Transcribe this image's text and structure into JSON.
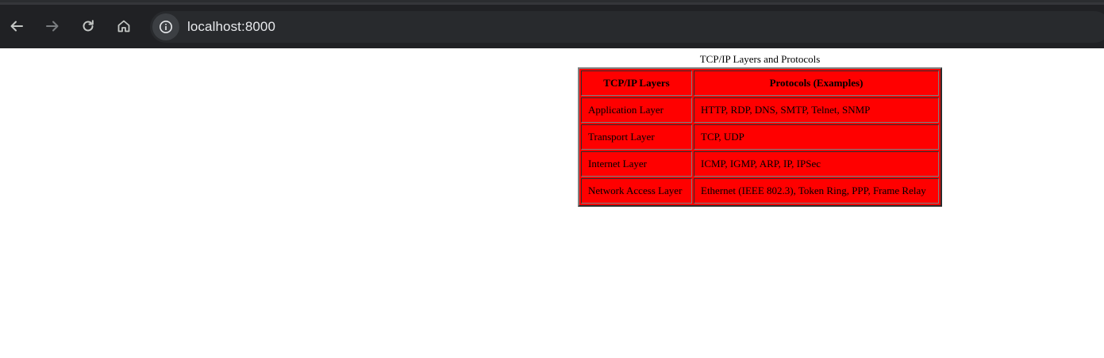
{
  "browser": {
    "url": "localhost:8000",
    "icons": {
      "back": "arrow-left-icon",
      "forward": "arrow-right-icon",
      "reload": "reload-icon",
      "home": "home-icon",
      "site_info": "info-icon"
    },
    "colors": {
      "toolbar": "#202124",
      "omnibox": "#282a2d",
      "text": "#e8eaed"
    }
  },
  "table": {
    "caption": "TCP/IP Layers and Protocols",
    "headers": [
      "TCP/IP Layers",
      "Protocols (Examples)"
    ],
    "rows": [
      [
        "Application Layer",
        "HTTP, RDP, DNS, SMTP, Telnet, SNMP"
      ],
      [
        "Transport Layer",
        "TCP, UDP"
      ],
      [
        "Internet Layer",
        "ICMP, IGMP, ARP, IP, IPSec"
      ],
      [
        "Network Access Layer",
        "Ethernet (IEEE 802.3), Token Ring, PPP, Frame Relay"
      ]
    ],
    "colors": {
      "background": "#ff0000",
      "border": "#808080"
    }
  }
}
